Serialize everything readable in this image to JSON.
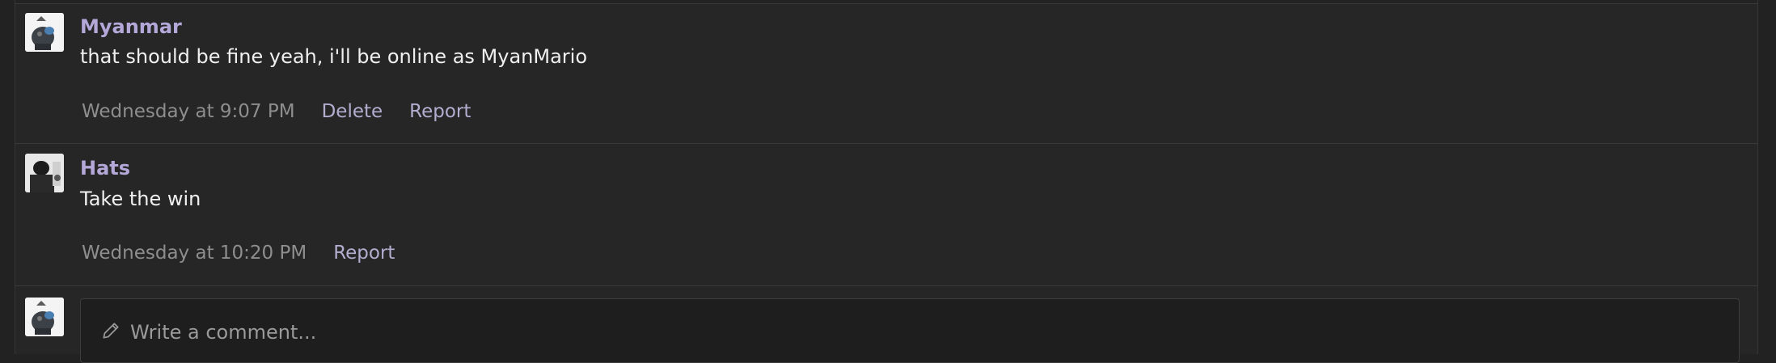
{
  "comments": [
    {
      "username": "Myanmar",
      "text": "that should be fine yeah, i'll be online as MyanMario",
      "time": "Wednesday at 9:07 PM",
      "actions": [
        "Delete",
        "Report"
      ]
    },
    {
      "username": "Hats",
      "text": "Take the win",
      "time": "Wednesday at 10:20 PM",
      "actions": [
        "Report"
      ]
    }
  ],
  "compose": {
    "placeholder": "Write a comment..."
  },
  "colors": {
    "username": "#b3a8d8",
    "link": "#b3aed0",
    "background": "#262626"
  }
}
